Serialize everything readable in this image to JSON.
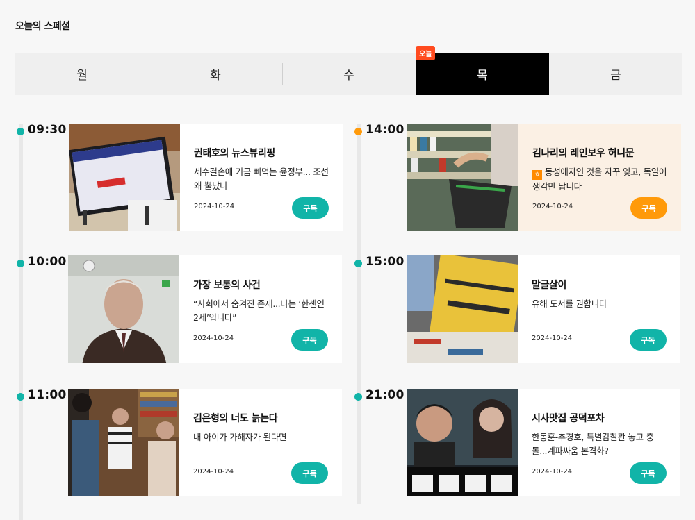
{
  "page_title": "오늘의 스페셜",
  "days": [
    {
      "label": "월",
      "active": false
    },
    {
      "label": "화",
      "active": false
    },
    {
      "label": "수",
      "active": false
    },
    {
      "label": "목",
      "active": true
    },
    {
      "label": "금",
      "active": false
    }
  ],
  "today_badge": "오늘",
  "colors": {
    "teal": "#11b4a8",
    "orange": "#ff9a0a",
    "active_tab": "#000000",
    "badge": "#ff4b1f",
    "highlight_card": "#fbf0e4"
  },
  "left_schedule": [
    {
      "time": "09:30",
      "title": "권태호의 뉴스뷰리핑",
      "desc": "세수결손에 기금 빼먹는 윤정부... 조선 왜 뿔났나",
      "date": "2024-10-24",
      "button": "구독",
      "thumb_icon": "press-briefing-image"
    },
    {
      "time": "10:00",
      "title": "가장 보통의 사건",
      "desc": "“사회에서 숨겨진 존재...나는 ‘한센인 2세’입니다”",
      "date": "2024-10-24",
      "button": "구독",
      "thumb_icon": "elderly-man-portrait-image"
    },
    {
      "time": "11:00",
      "title": "김은형의 너도 늙는다",
      "desc": "내 아이가 가해자가 된다면",
      "date": "2024-10-24",
      "button": "구독",
      "thumb_icon": "family-scene-image"
    }
  ],
  "right_schedule": [
    {
      "time": "14:00",
      "title": "김나리의 레인보우 허니문",
      "badge": "ㅎ",
      "desc": "동성애자인 것을 자꾸 잊고, 독일어 생각만 납니다",
      "date": "2024-10-24",
      "button": "구독",
      "highlight": true,
      "thumb_icon": "grocery-shopping-image"
    },
    {
      "time": "15:00",
      "title": "말글살이",
      "desc": "유해 도서를 권합니다",
      "date": "2024-10-24",
      "button": "구독",
      "highlight": false,
      "thumb_icon": "bookstore-display-image"
    },
    {
      "time": "21:00",
      "title": "시사맛집 공덕포차",
      "desc": "한동훈-추경호, 특별감찰관 놓고 충돌...계파싸움 본격화?",
      "date": "2024-10-24",
      "button": "구독",
      "highlight": false,
      "thumb_icon": "political-poster-image"
    }
  ]
}
